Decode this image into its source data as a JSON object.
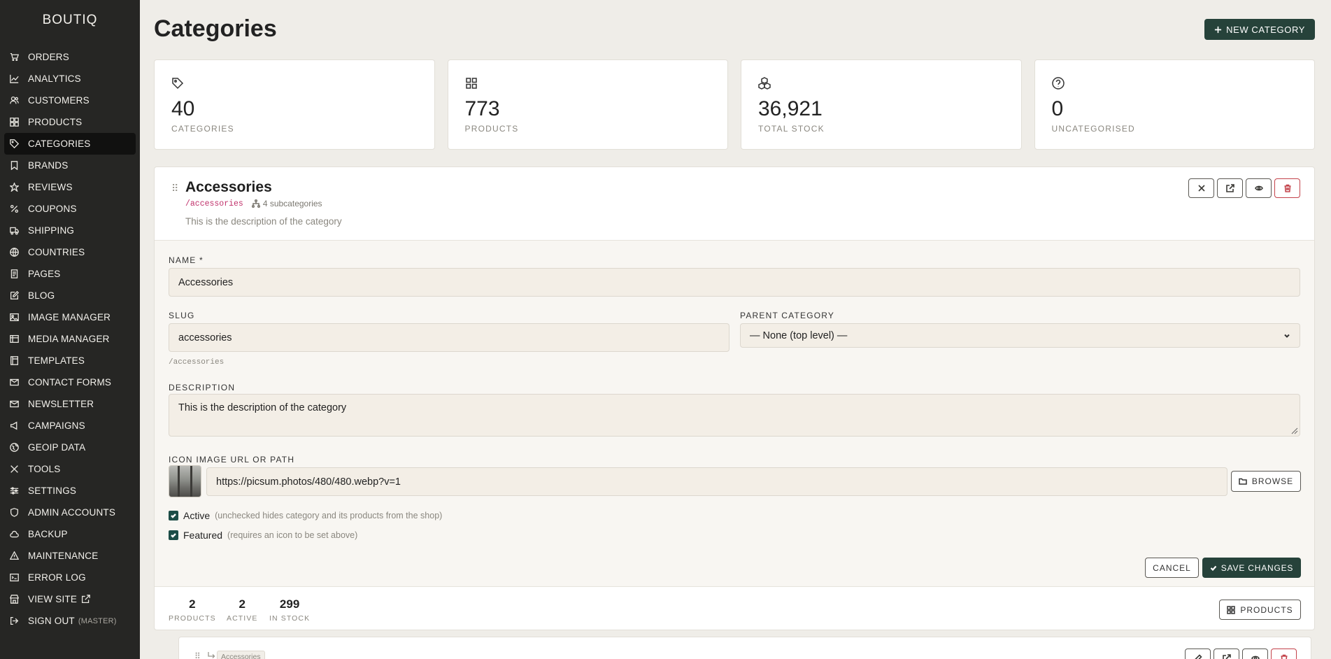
{
  "sidebar": {
    "brand": "BOUTIQ",
    "items": [
      {
        "label": "ORDERS",
        "icon": "cart-icon"
      },
      {
        "label": "ANALYTICS",
        "icon": "chart-line-icon"
      },
      {
        "label": "CUSTOMERS",
        "icon": "users-icon"
      },
      {
        "label": "PRODUCTS",
        "icon": "grid-icon"
      },
      {
        "label": "CATEGORIES",
        "icon": "tag-icon",
        "active": true
      },
      {
        "label": "BRANDS",
        "icon": "bookmark-icon"
      },
      {
        "label": "REVIEWS",
        "icon": "star-icon"
      },
      {
        "label": "COUPONS",
        "icon": "percent-icon"
      },
      {
        "label": "SHIPPING",
        "icon": "truck-icon"
      },
      {
        "label": "COUNTRIES",
        "icon": "globe-icon"
      },
      {
        "label": "PAGES",
        "icon": "page-icon"
      },
      {
        "label": "BLOG",
        "icon": "edit-icon"
      },
      {
        "label": "IMAGE MANAGER",
        "icon": "image-icon"
      },
      {
        "label": "MEDIA MANAGER",
        "icon": "media-icon"
      },
      {
        "label": "TEMPLATES",
        "icon": "template-icon"
      },
      {
        "label": "CONTACT FORMS",
        "icon": "mail-icon"
      },
      {
        "label": "NEWSLETTER",
        "icon": "envelope-icon"
      },
      {
        "label": "CAMPAIGNS",
        "icon": "megaphone-icon"
      },
      {
        "label": "GEOIP DATA",
        "icon": "globe-pin-icon"
      },
      {
        "label": "TOOLS",
        "icon": "tools-icon"
      },
      {
        "label": "SETTINGS",
        "icon": "sliders-icon"
      },
      {
        "label": "ADMIN ACCOUNTS",
        "icon": "shield-icon"
      },
      {
        "label": "BACKUP",
        "icon": "cloud-icon"
      },
      {
        "label": "MAINTENANCE",
        "icon": "warning-icon"
      },
      {
        "label": "ERROR LOG",
        "icon": "terminal-icon"
      },
      {
        "label": "VIEW SITE",
        "icon": "store-icon"
      },
      {
        "label": "SIGN OUT",
        "icon": "sign-out-icon",
        "suffix": "(MASTER)"
      }
    ]
  },
  "header": {
    "title": "Categories",
    "new_button": "NEW CATEGORY"
  },
  "stats": [
    {
      "value": "40",
      "label": "CATEGORIES",
      "icon": "tag-icon"
    },
    {
      "value": "773",
      "label": "PRODUCTS",
      "icon": "grid-icon"
    },
    {
      "value": "36,921",
      "label": "TOTAL STOCK",
      "icon": "boxes-icon"
    },
    {
      "value": "0",
      "label": "UNCATEGORISED",
      "icon": "question-icon"
    }
  ],
  "category": {
    "name": "Accessories",
    "slug": "/accessories",
    "subcategories": "4 subcategories",
    "description": "This is the description of the category"
  },
  "form": {
    "name_label": "NAME *",
    "name_value": "Accessories",
    "slug_label": "SLUG",
    "slug_value": "accessories",
    "slug_hint": "/accessories",
    "parent_label": "PARENT CATEGORY",
    "parent_value": "— None (top level) —",
    "description_label": "DESCRIPTION",
    "description_value": "This is the description of the category",
    "icon_label": "ICON IMAGE URL OR PATH",
    "icon_value": "https://picsum.photos/480/480.webp?v=1",
    "browse_label": "BROWSE",
    "active_label": "Active",
    "active_hint": "(unchecked hides category and its products from the shop)",
    "featured_label": "Featured",
    "featured_hint": "(requires an icon to be set above)",
    "cancel_label": "CANCEL",
    "save_label": "SAVE CHANGES"
  },
  "panel_stats": [
    {
      "value": "2",
      "label": "PRODUCTS"
    },
    {
      "value": "2",
      "label": "ACTIVE"
    },
    {
      "value": "299",
      "label": "IN STOCK"
    }
  ],
  "products_button": "PRODUCTS",
  "subcategory_preview": {
    "parent_tag": "Accessories"
  }
}
